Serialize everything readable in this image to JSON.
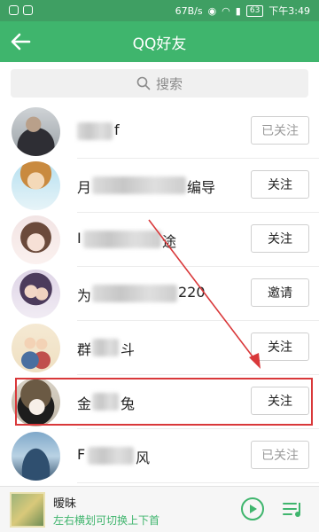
{
  "status_bar": {
    "speed": "67B/s",
    "battery": "63",
    "time": "下午3:49"
  },
  "header": {
    "title": "QQ好友"
  },
  "search": {
    "placeholder": "搜索"
  },
  "friends": [
    {
      "name_start": "",
      "name_end": "f",
      "action": "已关注",
      "action_style": "gray"
    },
    {
      "name_start": "月",
      "name_end": "编导",
      "action": "关注",
      "action_style": "normal"
    },
    {
      "name_start": "I",
      "name_end": "途",
      "action": "关注",
      "action_style": "normal"
    },
    {
      "name_start": "为",
      "name_end": "220",
      "action": "邀请",
      "action_style": "normal"
    },
    {
      "name_start": "群",
      "name_end": "斗",
      "action": "关注",
      "action_style": "normal"
    },
    {
      "name_start": "金",
      "name_end": "兔",
      "action": "关注",
      "action_style": "normal"
    },
    {
      "name_start": "F",
      "name_end": "风",
      "action": "已关注",
      "action_style": "gray"
    }
  ],
  "player": {
    "song": "暧昧",
    "hint": "左右横划可切换上下首"
  },
  "colors": {
    "header_green": "#3fb56d",
    "status_green": "#3f9f63",
    "highlight_red": "#d9383a"
  }
}
